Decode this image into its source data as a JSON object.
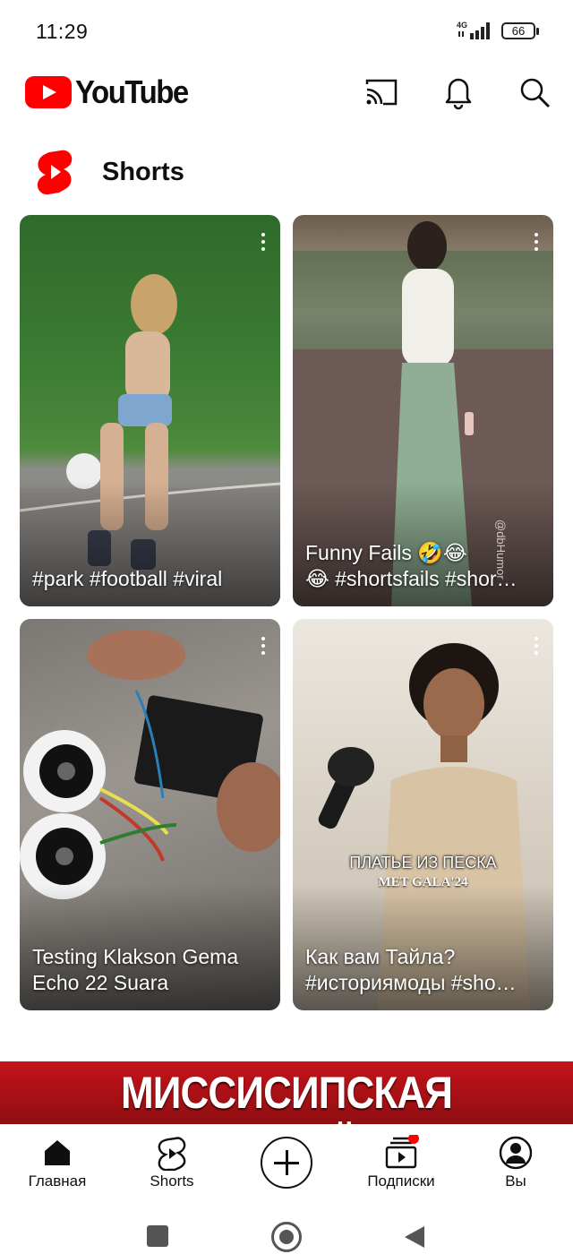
{
  "status_bar": {
    "time": "11:29",
    "network": "4G",
    "battery": "66"
  },
  "header": {
    "logo_text": "YouTube"
  },
  "section": {
    "title": "Shorts"
  },
  "shorts": [
    {
      "caption_lines": [
        "#park #football #viral"
      ]
    },
    {
      "caption_lines": [
        "Funny Fails 🤣😂",
        "😂 #shortsfails #shor…"
      ],
      "watermark": "@dbHumor"
    },
    {
      "caption_lines": [
        "Testing Klakson Gema",
        "Echo 22 Suara"
      ]
    },
    {
      "caption_lines": [
        "Как вам Тайла?",
        "#историямоды #sho…"
      ],
      "overlay_title": "ПЛАТЬЕ ИЗ ПЕСКА",
      "overlay_subtitle": "MET GALA'24"
    }
  ],
  "banner": {
    "text": "МИССИСИПСКАЯ БЕЗНАДЁГА"
  },
  "bottom_nav": [
    {
      "label": "Главная",
      "icon": "home-icon"
    },
    {
      "label": "Shorts",
      "icon": "shorts-icon"
    },
    {
      "label": "",
      "icon": "create-icon"
    },
    {
      "label": "Подписки",
      "icon": "subscriptions-icon"
    },
    {
      "label": "Вы",
      "icon": "account-icon"
    }
  ],
  "colors": {
    "brand_red": "#ff0000",
    "text": "#0f0f0f",
    "notification_dot": "#ff0000"
  }
}
